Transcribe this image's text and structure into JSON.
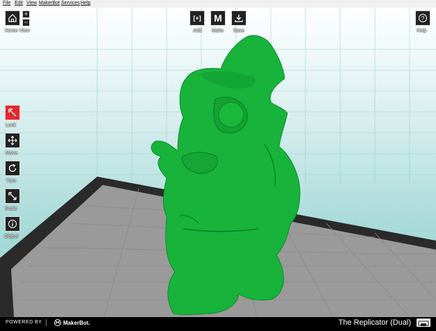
{
  "menu": [
    "File",
    "Edit",
    "View",
    "MakerBot",
    "Services",
    "Help"
  ],
  "home_view": {
    "label": "Home View",
    "zoom_in": "+",
    "zoom_out": "−"
  },
  "top_toolbar": {
    "add": "Add",
    "make": "Make",
    "save": "Save",
    "add_glyph": "[+]",
    "make_glyph": "M"
  },
  "help": {
    "label": "Help",
    "glyph": "?"
  },
  "tools": [
    {
      "label": "Look",
      "icon": "look-arrow-icon",
      "active": true
    },
    {
      "label": "Move",
      "icon": "move-arrows-icon",
      "active": false
    },
    {
      "label": "Turn",
      "icon": "rotate-icon",
      "active": false
    },
    {
      "label": "Scale",
      "icon": "scale-arrow-icon",
      "active": false
    },
    {
      "label": "Object",
      "icon": "info-icon",
      "active": false
    }
  ],
  "footer": {
    "powered_by": "POWERED BY",
    "brand": "MakerBot.",
    "machine": "The Replicator (Dual)"
  },
  "colors": {
    "accent_red": "#e22a2f",
    "model_green": "#17b33a",
    "platform_gray": "#9a9a9a"
  }
}
